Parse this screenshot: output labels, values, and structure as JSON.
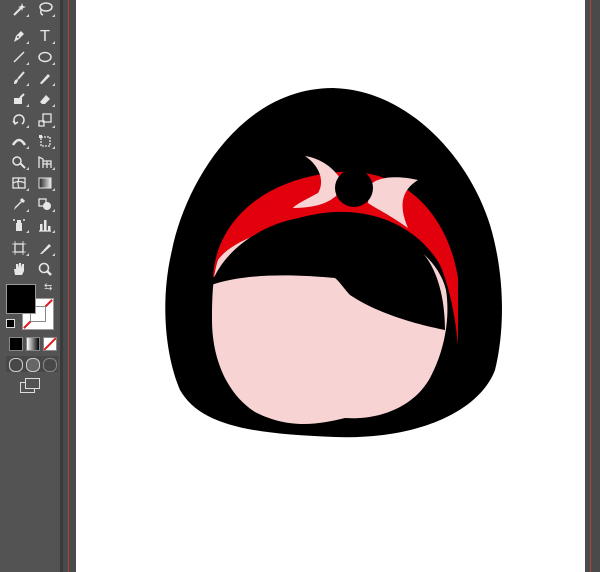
{
  "toolbar": {
    "tools": [
      {
        "name": "magic-wand-tool",
        "icon": "magic-wand-icon"
      },
      {
        "name": "lasso-tool",
        "icon": "lasso-icon"
      },
      {
        "name": "pen-tool",
        "icon": "pen-icon"
      },
      {
        "name": "type-tool",
        "icon": "type-icon",
        "glyph": "T"
      },
      {
        "name": "line-segment-tool",
        "icon": "line-icon"
      },
      {
        "name": "ellipse-tool",
        "icon": "ellipse-icon"
      },
      {
        "name": "paintbrush-tool",
        "icon": "paintbrush-icon"
      },
      {
        "name": "pencil-tool",
        "icon": "pencil-icon"
      },
      {
        "name": "blob-brush-tool",
        "icon": "blob-brush-icon"
      },
      {
        "name": "eraser-tool",
        "icon": "eraser-icon"
      },
      {
        "name": "rotate-tool",
        "icon": "rotate-icon"
      },
      {
        "name": "scale-tool",
        "icon": "scale-icon"
      },
      {
        "name": "width-tool",
        "icon": "width-icon"
      },
      {
        "name": "free-transform-tool",
        "icon": "free-transform-icon"
      },
      {
        "name": "shape-builder-tool",
        "icon": "shape-builder-icon"
      },
      {
        "name": "perspective-grid-tool",
        "icon": "perspective-grid-icon"
      },
      {
        "name": "mesh-tool",
        "icon": "mesh-icon"
      },
      {
        "name": "gradient-tool",
        "icon": "gradient-icon"
      },
      {
        "name": "eyedropper-tool",
        "icon": "eyedropper-icon"
      },
      {
        "name": "blend-tool",
        "icon": "blend-icon"
      },
      {
        "name": "symbol-sprayer-tool",
        "icon": "symbol-sprayer-icon"
      },
      {
        "name": "column-graph-tool",
        "icon": "column-graph-icon"
      },
      {
        "name": "artboard-tool",
        "icon": "artboard-icon"
      },
      {
        "name": "slice-tool",
        "icon": "slice-icon"
      },
      {
        "name": "hand-tool",
        "icon": "hand-icon"
      },
      {
        "name": "zoom-tool",
        "icon": "zoom-icon"
      }
    ],
    "fill_color": "#000000",
    "stroke_color": "none"
  },
  "colors": {
    "hair": "#000000",
    "face": "#f8d3d4",
    "headband": "#e1000b",
    "bow": "#f8d3d4",
    "guide": "#b0413b"
  }
}
